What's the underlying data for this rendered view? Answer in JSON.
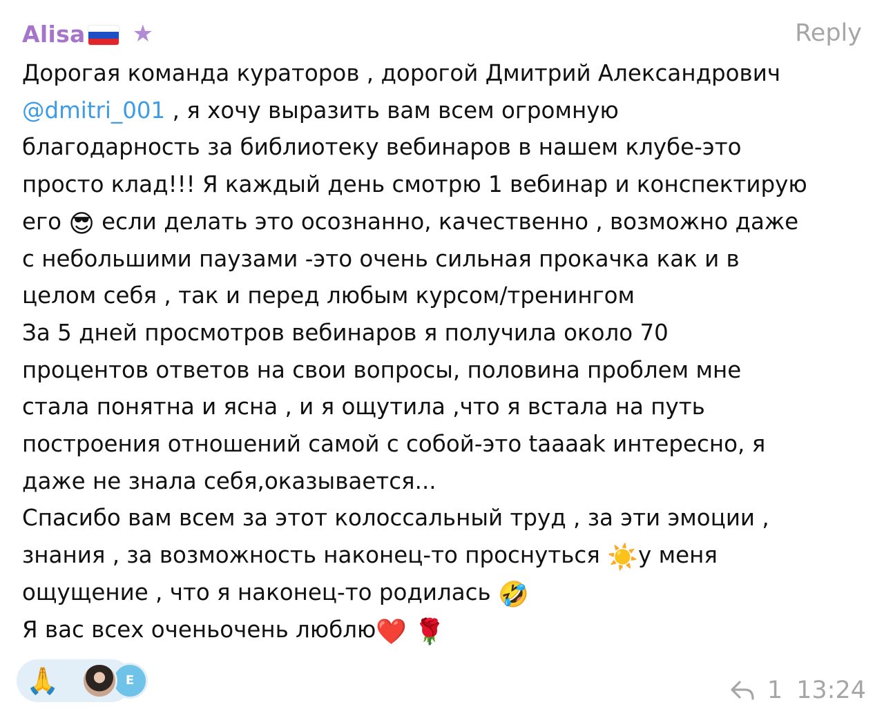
{
  "message": {
    "author": "Alisa",
    "author_color": "#a674c9",
    "flag_icon": "russia-flag-icon",
    "badge_icon": "star-icon",
    "reply_label": "Reply",
    "mention": "@dmitri_001",
    "mention_color": "#3d9ce5",
    "lines": [
      "Дорогая команда кураторов , дорогой Дмитрий Александрович",
      " , я хочу выразить вам всем огромную",
      "благодарность за библиотеку вебинаров в нашем клубе-это",
      "просто клад!!! Я каждый день смотрю 1 вебинар и конспектирую",
      "его",
      " если делать это осознанно, качественно , возможно даже",
      "с небольшими паузами -это очень сильная прокачка как и в",
      "целом себя , так и перед любым курсом/тренингом",
      "За 5 дней просмотров вебинаров я получила около 70",
      "процентов ответов на свои вопросы, половина проблем мне",
      "стала понятна и ясна , и я ощутила ,что я встала на путь",
      "построения отношений самой с собой-это taaaak интересно, я",
      "даже не знала себя,оказывается...",
      "Спасибо вам всем за этот колоссальный труд , за эти эмоции ,",
      "знания , за возможность наконец-то проснуться",
      "у меня",
      "ощущение , что я наконец-то родилась",
      "Я вас всех оченьочень люблю"
    ],
    "emojis": {
      "sunglasses": "😎",
      "sun": "☀️",
      "rofl": "🤣",
      "heart": "❤️",
      "rose": "🌹"
    },
    "reactions": {
      "emoji": "🙏",
      "avatar_letter": "E"
    },
    "reply_count": "1",
    "time": "13:24"
  }
}
